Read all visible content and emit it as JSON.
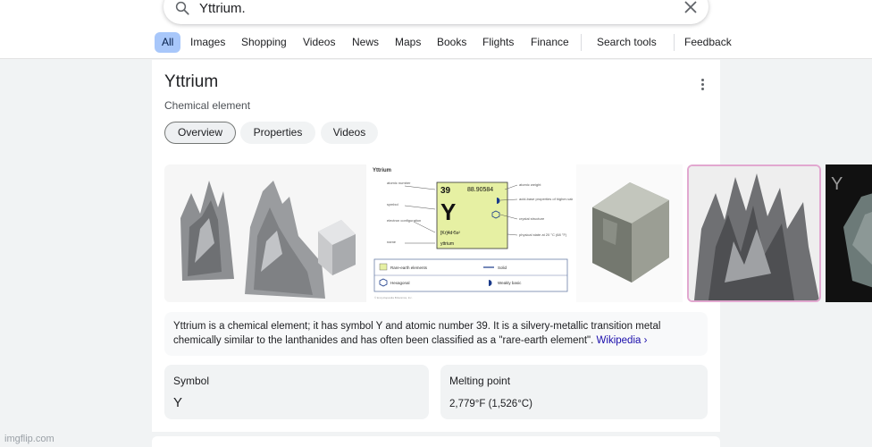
{
  "search": {
    "query": "Yttrium."
  },
  "tabs": [
    {
      "label": "All"
    },
    {
      "label": "Images"
    },
    {
      "label": "Shopping"
    },
    {
      "label": "Videos"
    },
    {
      "label": "News"
    },
    {
      "label": "Maps"
    },
    {
      "label": "Books"
    },
    {
      "label": "Flights"
    },
    {
      "label": "Finance"
    },
    {
      "label": "Search tools"
    },
    {
      "label": "Feedback"
    }
  ],
  "panel": {
    "title": "Yttrium",
    "subtitle": "Chemical element",
    "chips": [
      {
        "label": "Overview"
      },
      {
        "label": "Properties"
      },
      {
        "label": "Videos"
      }
    ],
    "element_card": {
      "name": "Yttrium",
      "atomic_number": "39",
      "atomic_weight": "88.90584",
      "symbol": "Y",
      "config": "[Kr]4d¹5s²",
      "name_label": "yttrium",
      "left_labels": [
        "atomic number",
        "symbol",
        "electron configuration",
        "name"
      ],
      "right_labels": [
        "atomic weight",
        "acid-base properties of higher-valence oxides",
        "crystal structure",
        "physical state at 20 °C (68 °F)"
      ],
      "legend": [
        "Rare-earth elements",
        "Solid",
        "Hexagonal",
        "Weakly basic"
      ],
      "credit": "© Encyclopædia Britannica, Inc."
    },
    "thumb_letter": "Y",
    "description": "Yttrium is a chemical element; it has symbol Y and atomic number 39. It is a silvery-metallic transition metal chemically similar to the lanthanides and has often been classified as a \"rare-earth element\".",
    "wikipedia": "Wikipedia ›",
    "facts": [
      {
        "label": "Symbol",
        "value": "Y"
      },
      {
        "label": "Melting point",
        "value": "2,779°F (1,526°C)"
      }
    ]
  },
  "watermark": "imgflip.com",
  "colors": {
    "active_tab_bg": "#a8c7fa",
    "link": "#1a0dab",
    "card_bg": "#ffffff",
    "page_bg": "#f1f3f4",
    "element_box": "#e6f0a3"
  }
}
